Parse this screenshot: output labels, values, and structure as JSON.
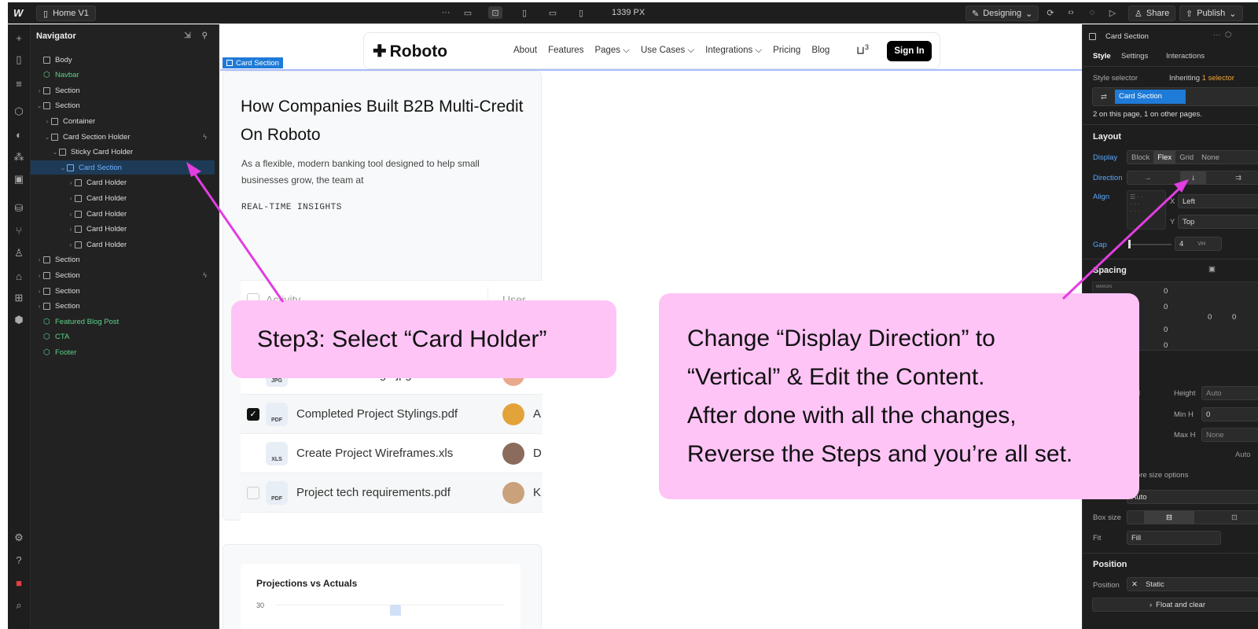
{
  "topbar": {
    "logo": "W",
    "page_name": "Home V1",
    "more": "···",
    "width_readout": "1339 PX",
    "mode": "Designing",
    "share": "Share",
    "publish": "Publish"
  },
  "navigator": {
    "title": "Navigator",
    "tree": [
      {
        "label": "Body",
        "depth": 0,
        "type": "box",
        "caret": ""
      },
      {
        "label": "Navbar",
        "depth": 0,
        "type": "component",
        "caret": ""
      },
      {
        "label": "Section",
        "depth": 0,
        "type": "box",
        "caret": "›"
      },
      {
        "label": "Section",
        "depth": 0,
        "type": "box",
        "caret": "⌄"
      },
      {
        "label": "Container",
        "depth": 1,
        "type": "box",
        "caret": "›"
      },
      {
        "label": "Card Section Holder",
        "depth": 1,
        "type": "box",
        "caret": "⌄",
        "bolt": true
      },
      {
        "label": "Sticky Card Holder",
        "depth": 2,
        "type": "box",
        "caret": "⌄"
      },
      {
        "label": "Card Section",
        "depth": 3,
        "type": "box",
        "caret": "⌄",
        "selected": true
      },
      {
        "label": "Card Holder",
        "depth": 4,
        "type": "box",
        "caret": "›"
      },
      {
        "label": "Card Holder",
        "depth": 4,
        "type": "box",
        "caret": "›"
      },
      {
        "label": "Card Holder",
        "depth": 4,
        "type": "box",
        "caret": "›"
      },
      {
        "label": "Card Holder",
        "depth": 4,
        "type": "box",
        "caret": "›"
      },
      {
        "label": "Card Holder",
        "depth": 4,
        "type": "box",
        "caret": "›"
      },
      {
        "label": "Section",
        "depth": 0,
        "type": "box",
        "caret": "›"
      },
      {
        "label": "Section",
        "depth": 0,
        "type": "box",
        "caret": "›",
        "bolt": true
      },
      {
        "label": "Section",
        "depth": 0,
        "type": "box",
        "caret": "›"
      },
      {
        "label": "Section",
        "depth": 0,
        "type": "box",
        "caret": "›"
      },
      {
        "label": "Featured Blog Post",
        "depth": 0,
        "type": "component",
        "caret": ""
      },
      {
        "label": "CTA",
        "depth": 0,
        "type": "component",
        "caret": ""
      },
      {
        "label": "Footer",
        "depth": 0,
        "type": "component",
        "caret": ""
      }
    ]
  },
  "canvas": {
    "selected_tag": "Card Section",
    "site": {
      "brand": "Roboto",
      "links": [
        "About",
        "Features",
        "Pages ⌵",
        "Use Cases ⌵",
        "Integrations ⌵",
        "Pricing",
        "Blog"
      ],
      "cart_count": "3",
      "signin": "Sign In"
    },
    "card": {
      "title": "How Companies Built B2B Multi-Credit On Roboto",
      "desc": "As a flexible, modern banking tool designed to help small businesses grow, the team at",
      "kicker": "REAL-TIME INSIGHTS",
      "col_activity": "Activity",
      "col_user": "User",
      "files": [
        {
          "name": "Dashboard-design.jpg",
          "ext": "JPG",
          "user": "K",
          "checked": false,
          "avatar": "#e9a98d"
        },
        {
          "name": "Completed Project Stylings.pdf",
          "ext": "PDF",
          "user": "A",
          "checked": true,
          "avatar": "#e3a33b"
        },
        {
          "name": "Create Project Wireframes.xls",
          "ext": "XLS",
          "user": "D",
          "checked": false,
          "avatar": "#8a6b5c"
        },
        {
          "name": "Project tech requirements.pdf",
          "ext": "PDF",
          "user": "K",
          "checked": false,
          "avatar": "#c9a27c"
        }
      ]
    },
    "card2": {
      "chart_title": "Projections vs Actuals",
      "chart_y": "30"
    }
  },
  "panel": {
    "element": "Card Section",
    "tabs": [
      "Style",
      "Settings",
      "Interactions"
    ],
    "style_selector_label": "Style selector",
    "inheriting_prefix": "Inheriting",
    "inheriting_count": "1 selector",
    "selector_chip": "Card Section",
    "usage": "2 on this page, 1 on other pages.",
    "layout_title": "Layout",
    "display_label": "Display",
    "display_options": [
      "Block",
      "Flex",
      "Grid",
      "None"
    ],
    "direction_label": "Direction",
    "direction_options": [
      "→",
      "↓",
      "⇉"
    ],
    "align_label": "Align",
    "x_label": "X",
    "x_value": "Left",
    "y_label": "Y",
    "y_value": "Top",
    "gap_label": "Gap",
    "gap_value": "4",
    "gap_unit": "VH",
    "spacing_title": "Spacing",
    "margin_label": "MARGIN",
    "zero": "0",
    "height_label": "Height",
    "height_value": "Auto",
    "minh_label": "Min H",
    "minh_value": "0",
    "maxh_label": "Max H",
    "maxh_value": "None",
    "vh_unit": "VH",
    "px_unit": "PX",
    "auto_label": "Auto",
    "more_size": "More size options",
    "ratio_value": "Auto",
    "boxsize_label": "Box size",
    "fit_label": "Fit",
    "fit_value": "Fill",
    "position_title": "Position",
    "position_label": "Position",
    "position_value": "Static",
    "float_clear": "Float and clear"
  },
  "callouts": {
    "step3": "Step3: Select  “Card Holder”",
    "lines": [
      "Change “Display Direction” to",
      "“Vertical” & Edit the Content.",
      "After done with all the changes,",
      "Reverse the Steps and you’re all set."
    ]
  },
  "colors": {
    "accent": "#1e7bd8",
    "callout": "#ffc4f6",
    "arrow": "#e23ee0",
    "component": "#5fd08a"
  }
}
